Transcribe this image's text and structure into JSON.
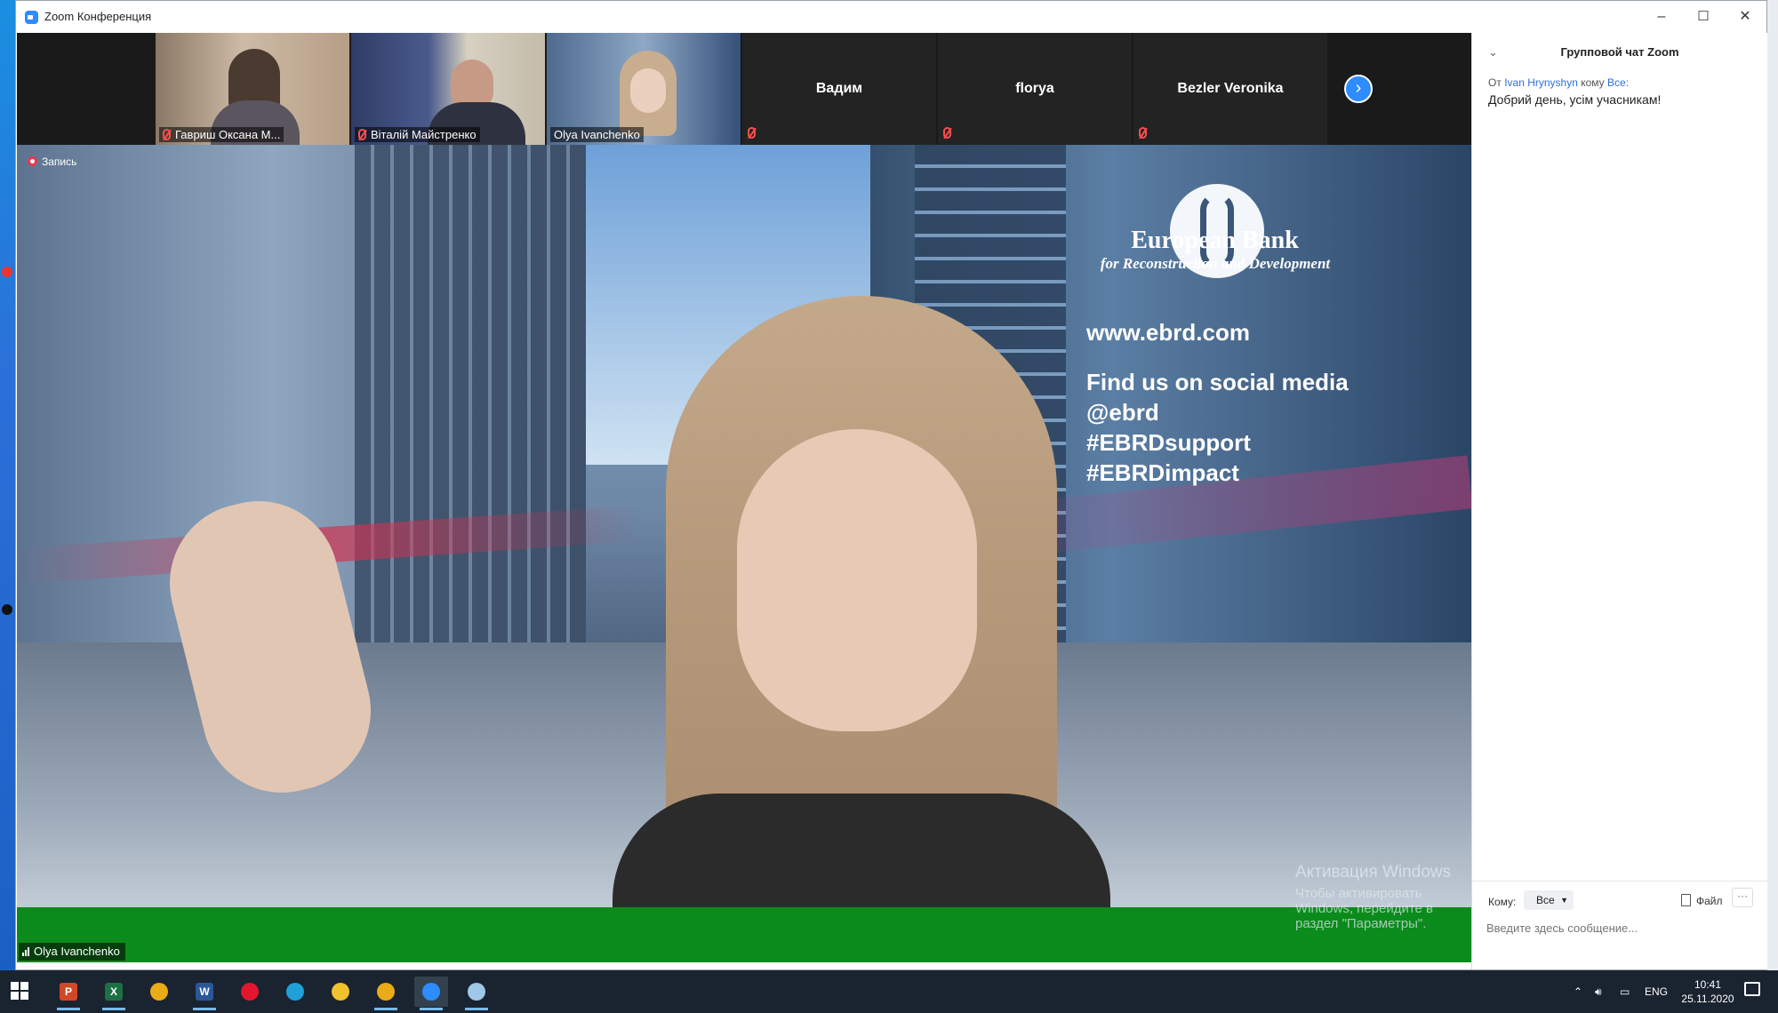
{
  "window": {
    "title": "Zoom Конференция",
    "minimize": "–",
    "maximize": "☐",
    "close": "✕"
  },
  "gallery": {
    "participants": [
      {
        "name": "Гавриш Оксана М...",
        "muted": true,
        "video": true
      },
      {
        "name": "Віталій Майстренко",
        "muted": true,
        "video": true
      },
      {
        "name": "Olya Ivanchenko",
        "muted": false,
        "video": true,
        "active": true
      },
      {
        "name": "Вадим",
        "muted": true,
        "video": false
      },
      {
        "name": "florya",
        "muted": true,
        "video": false
      },
      {
        "name": "Bezler Veronika",
        "muted": true,
        "video": false
      }
    ],
    "next_icon": "›"
  },
  "main_video": {
    "recording_label": "Запись",
    "speaker_name": "Olya Ivanchenko",
    "background": {
      "bank_name": "European Bank",
      "bank_subtitle": "for Reconstruction and Development",
      "website": "www.ebrd.com",
      "social_lines": [
        "Find us on social media",
        "@ebrd",
        "#EBRDsupport",
        "#EBRDimpact"
      ]
    },
    "watermark_title": "Активация Windows",
    "watermark_text": "Чтобы активировать Windows, перейдите в раздел \"Параметры\"."
  },
  "chat": {
    "title": "Групповой чат Zoom",
    "message": {
      "from_label": "От",
      "sender": "Ivan Hrynyshyn",
      "to_label": "кому",
      "recipient": "Все:",
      "text": "Добрий день, усім учасникам!"
    },
    "to_field_label": "Кому:",
    "to_value": "Все",
    "file_label": "Файл",
    "more_label": "···",
    "input_placeholder": "Введите здесь сообщение..."
  },
  "taskbar": {
    "apps": [
      {
        "icon": "powerpoint-icon",
        "glyph": "P",
        "color": "#d24726",
        "running": true
      },
      {
        "icon": "excel-icon",
        "glyph": "X",
        "color": "#1d7044",
        "running": true
      },
      {
        "icon": "chrome-icon",
        "glyph": "",
        "color": "#e9ab17",
        "running": false
      },
      {
        "icon": "word-icon",
        "glyph": "W",
        "color": "#2b579a",
        "running": true
      },
      {
        "icon": "opera-icon",
        "glyph": "",
        "color": "#e3162f",
        "running": false
      },
      {
        "icon": "edge-icon",
        "glyph": "",
        "color": "#1fa0d8",
        "running": false
      },
      {
        "icon": "file-explorer-icon",
        "glyph": "",
        "color": "#f2c12e",
        "running": false
      },
      {
        "icon": "chrome-icon",
        "glyph": "",
        "color": "#e9ab17",
        "running": true
      },
      {
        "icon": "zoom-icon",
        "glyph": "",
        "color": "#2d8cff",
        "running": true,
        "active": true
      },
      {
        "icon": "paint-icon",
        "glyph": "",
        "color": "#9ec7e8",
        "running": true
      }
    ],
    "language": "ENG",
    "time": "10:41",
    "date": "25.11.2020"
  }
}
